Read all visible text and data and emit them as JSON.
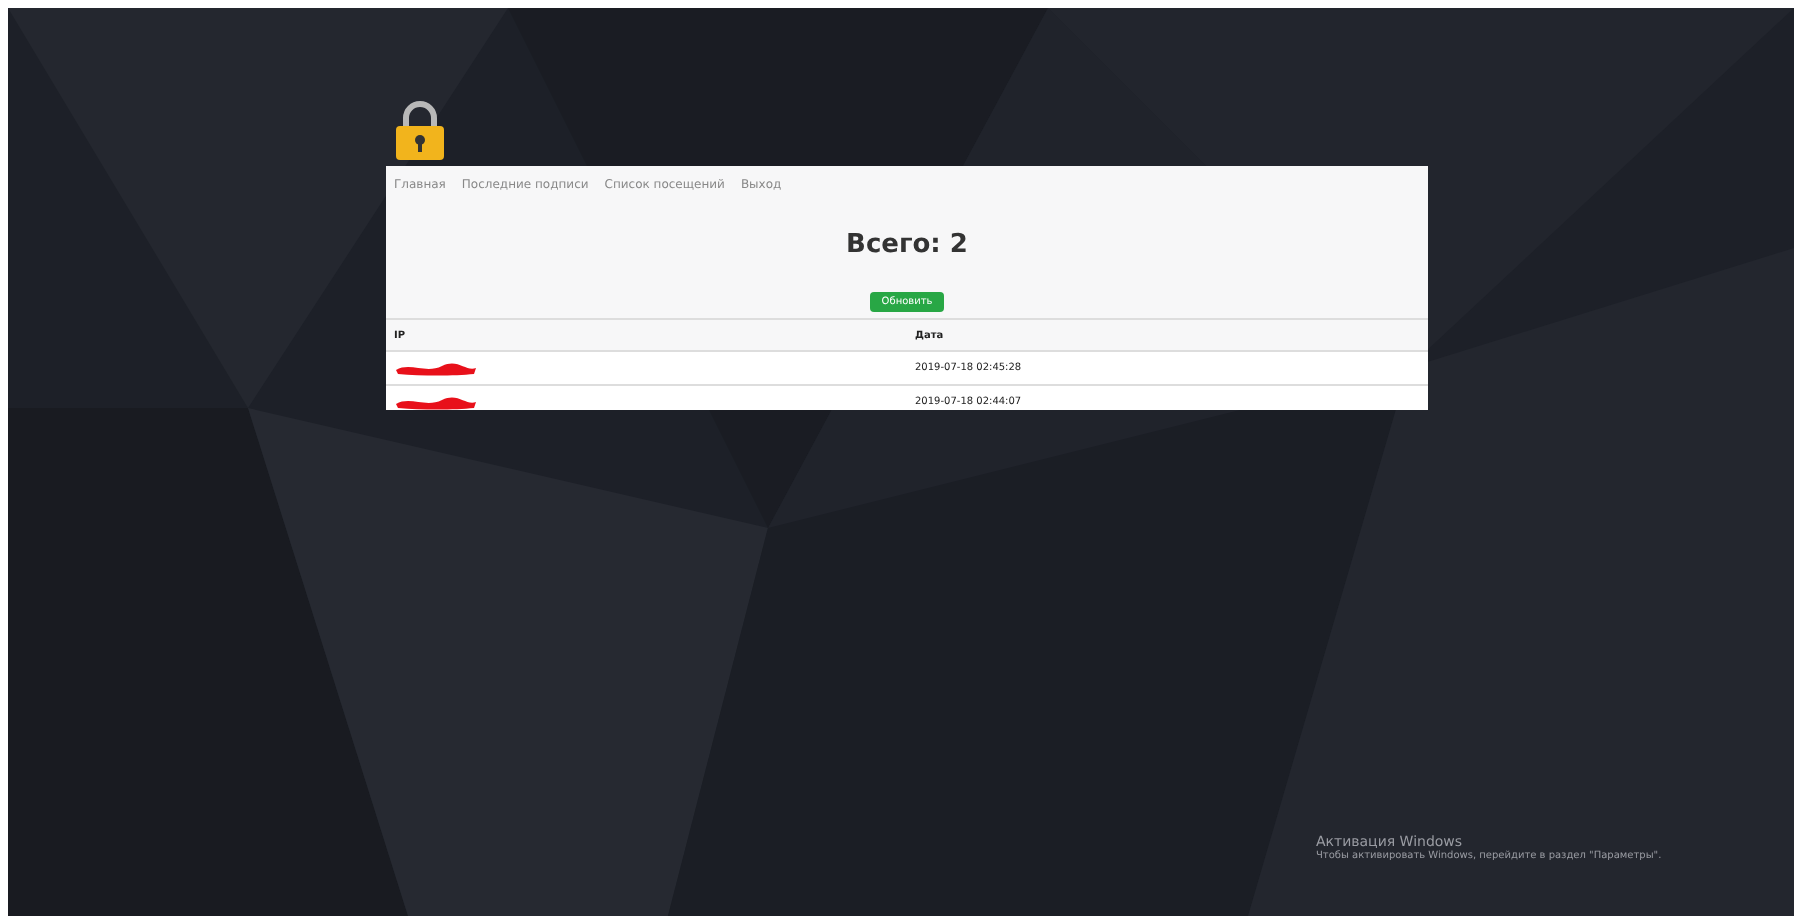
{
  "nav": [
    "Главная",
    "Последние подписи",
    "Список посещений",
    "Выход"
  ],
  "heading": "Всего: 2",
  "button": "Обновить",
  "table": {
    "columns": [
      "IP",
      "Дата"
    ],
    "rows": [
      {
        "ip_redacted": true,
        "date": "2019-07-18 02:45:28"
      },
      {
        "ip_redacted": true,
        "date": "2019-07-18 02:44:07"
      }
    ]
  },
  "activation": {
    "title": "Активация Windows",
    "text": "Чтобы активировать Windows, перейдите в раздел \"Параметры\"."
  }
}
